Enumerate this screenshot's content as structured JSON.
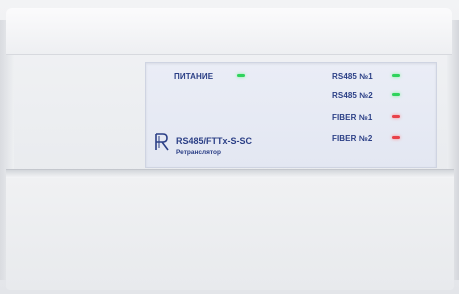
{
  "panel": {
    "power_label": "ПИТАНИЕ",
    "indicators": [
      {
        "label": "RS485 №1",
        "status": "green"
      },
      {
        "label": "RS485 №2",
        "status": "green"
      },
      {
        "label": "FIBER №1",
        "status": "red"
      },
      {
        "label": "FIBER №2",
        "status": "red"
      }
    ],
    "model": "RS485/FTTx-S-SC",
    "subtitle": "Ретранслятор"
  },
  "colors": {
    "label_text": "#2b3f86",
    "led_green": "#2fd35c",
    "led_red": "#e8424a",
    "panel_bg": "#e6e9f4"
  }
}
